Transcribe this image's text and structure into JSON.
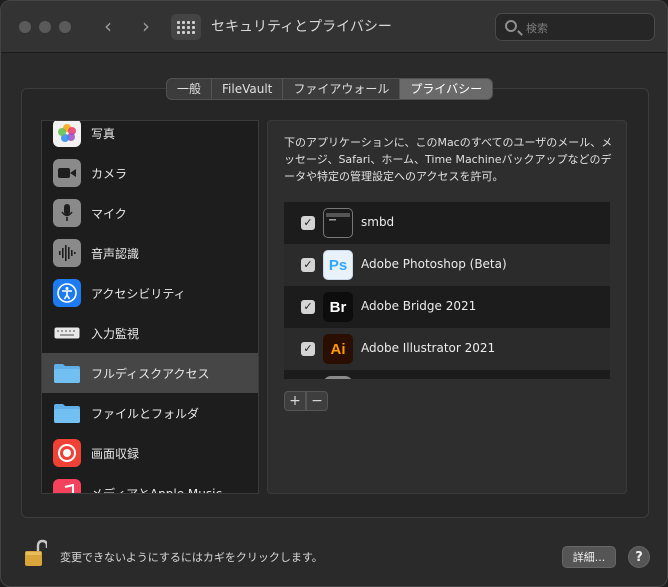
{
  "window": {
    "title": "セキュリティとプライバシー",
    "search_placeholder": "検索"
  },
  "tabs": [
    {
      "label": "一般",
      "active": false
    },
    {
      "label": "FileVault",
      "active": false
    },
    {
      "label": "ファイアウォール",
      "active": false
    },
    {
      "label": "プライバシー",
      "active": true
    }
  ],
  "sidebar": {
    "items": [
      {
        "label": "写真",
        "icon": "photos-icon",
        "selected": false
      },
      {
        "label": "カメラ",
        "icon": "camera-icon",
        "selected": false
      },
      {
        "label": "マイク",
        "icon": "microphone-icon",
        "selected": false
      },
      {
        "label": "音声認識",
        "icon": "speech-recognition-icon",
        "selected": false
      },
      {
        "label": "アクセシビリティ",
        "icon": "accessibility-icon",
        "selected": false
      },
      {
        "label": "入力監視",
        "icon": "keyboard-icon",
        "selected": false
      },
      {
        "label": "フルディスクアクセス",
        "icon": "folder-icon",
        "selected": true
      },
      {
        "label": "ファイルとフォルダ",
        "icon": "folder-icon",
        "selected": false
      },
      {
        "label": "画面収録",
        "icon": "screen-recording-icon",
        "selected": false
      },
      {
        "label": "メディアとApple Music",
        "icon": "music-icon",
        "selected": false
      }
    ]
  },
  "detail": {
    "description": "下のアプリケーションに、このMacのすべてのユーザのメール、メッセージ、Safari、ホーム、Time Machineバックアップなどのデータや特定の管理設定へのアクセスを許可。",
    "apps": [
      {
        "label": "smbd",
        "checked": true,
        "icon": "terminal-icon"
      },
      {
        "label": "Adobe Photoshop (Beta)",
        "checked": true,
        "icon": "photoshop-icon",
        "icon_text": "Ps"
      },
      {
        "label": "Adobe Bridge 2021",
        "checked": true,
        "icon": "bridge-icon",
        "icon_text": "Br"
      },
      {
        "label": "Adobe Illustrator 2021",
        "checked": true,
        "icon": "illustrator-icon",
        "icon_text": "Ai"
      }
    ],
    "add_label": "+",
    "remove_label": "−"
  },
  "footer": {
    "lock_text": "変更できないようにするにはカギをクリックします。",
    "advanced_label": "詳細...",
    "help_label": "?"
  },
  "colors": {
    "photoshop": "#31a8ff",
    "bridge": "#ffffff",
    "illustrator": "#ff9a00",
    "folder": "#5fb0e8",
    "accessibility": "#1d7bf0",
    "screen_recording": "#ef4135"
  }
}
